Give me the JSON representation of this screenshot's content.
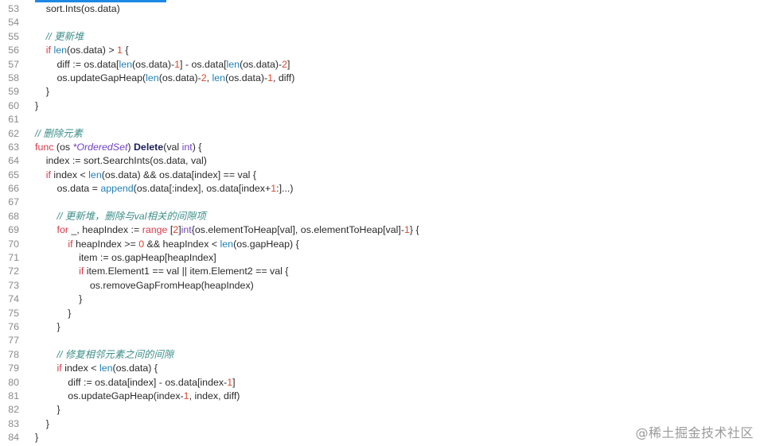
{
  "colors": {
    "keyword": "#d73a49",
    "builtin": "#1f7fb7",
    "number": "#d9482b",
    "comment": "#3d8f8a",
    "type": "#6f42c1",
    "text": "#2b2b2b",
    "accent": "#1e88e5"
  },
  "watermark": "@稀土掘金技术社区",
  "lines": [
    {
      "n": "53",
      "t": [
        [
          "",
          "    sort.Ints(os.data)"
        ]
      ]
    },
    {
      "n": "54",
      "t": []
    },
    {
      "n": "55",
      "t": [
        [
          "",
          "    "
        ],
        [
          "cm",
          "// 更新堆"
        ]
      ]
    },
    {
      "n": "56",
      "t": [
        [
          "",
          "    "
        ],
        [
          "kw",
          "if"
        ],
        [
          "",
          " "
        ],
        [
          "fn",
          "len"
        ],
        [
          "",
          "(os.data) > "
        ],
        [
          "num",
          "1"
        ],
        [
          "",
          " {"
        ]
      ]
    },
    {
      "n": "57",
      "t": [
        [
          "",
          "        diff := os.data["
        ],
        [
          "fn",
          "len"
        ],
        [
          "",
          "(os.data)-"
        ],
        [
          "num",
          "1"
        ],
        [
          "",
          "] - os.data["
        ],
        [
          "fn",
          "len"
        ],
        [
          "",
          "(os.data)-"
        ],
        [
          "num",
          "2"
        ],
        [
          "",
          "]"
        ]
      ]
    },
    {
      "n": "58",
      "t": [
        [
          "",
          "        os.updateGapHeap("
        ],
        [
          "fn",
          "len"
        ],
        [
          "",
          "(os.data)-"
        ],
        [
          "num",
          "2"
        ],
        [
          "",
          ", "
        ],
        [
          "fn",
          "len"
        ],
        [
          "",
          "(os.data)-"
        ],
        [
          "num",
          "1"
        ],
        [
          "",
          ", diff)"
        ]
      ]
    },
    {
      "n": "59",
      "t": [
        [
          "",
          "    }"
        ]
      ]
    },
    {
      "n": "60",
      "t": [
        [
          "",
          "}"
        ]
      ]
    },
    {
      "n": "61",
      "t": []
    },
    {
      "n": "62",
      "t": [
        [
          "cm",
          "// 删除元素"
        ]
      ]
    },
    {
      "n": "63",
      "t": [
        [
          "kw",
          "func"
        ],
        [
          "",
          " (os "
        ],
        [
          "it",
          "*OrderedSet"
        ],
        [
          "",
          ") "
        ],
        [
          "bold",
          "Delete"
        ],
        [
          "",
          "(val "
        ],
        [
          "ty",
          "int"
        ],
        [
          "",
          ") {"
        ]
      ]
    },
    {
      "n": "64",
      "t": [
        [
          "",
          "    index := sort.SearchInts(os.data, val)"
        ]
      ]
    },
    {
      "n": "65",
      "t": [
        [
          "",
          "    "
        ],
        [
          "kw",
          "if"
        ],
        [
          "",
          " index < "
        ],
        [
          "fn",
          "len"
        ],
        [
          "",
          "(os.data) && os.data[index] == val {"
        ]
      ]
    },
    {
      "n": "66",
      "t": [
        [
          "",
          "        os.data = "
        ],
        [
          "fn",
          "append"
        ],
        [
          "",
          "(os.data[:index], os.data[index+"
        ],
        [
          "num",
          "1"
        ],
        [
          "",
          ":]...)"
        ]
      ]
    },
    {
      "n": "67",
      "t": []
    },
    {
      "n": "68",
      "t": [
        [
          "",
          "        "
        ],
        [
          "cm",
          "// 更新堆，删除与val相关的间隙项"
        ]
      ]
    },
    {
      "n": "69",
      "t": [
        [
          "",
          "        "
        ],
        [
          "kw",
          "for"
        ],
        [
          "",
          " _, heapIndex := "
        ],
        [
          "kw",
          "range"
        ],
        [
          "",
          " ["
        ],
        [
          "num",
          "2"
        ],
        [
          "",
          "]"
        ],
        [
          "ty",
          "int"
        ],
        [
          "",
          "{os.elementToHeap[val], os.elementToHeap[val]-"
        ],
        [
          "num",
          "1"
        ],
        [
          "",
          "} {"
        ]
      ]
    },
    {
      "n": "70",
      "t": [
        [
          "",
          "            "
        ],
        [
          "kw",
          "if"
        ],
        [
          "",
          " heapIndex >= "
        ],
        [
          "num",
          "0"
        ],
        [
          "",
          " && heapIndex < "
        ],
        [
          "fn",
          "len"
        ],
        [
          "",
          "(os.gapHeap) {"
        ]
      ]
    },
    {
      "n": "71",
      "t": [
        [
          "",
          "                item := os.gapHeap[heapIndex]"
        ]
      ]
    },
    {
      "n": "72",
      "t": [
        [
          "",
          "                "
        ],
        [
          "kw",
          "if"
        ],
        [
          "",
          " item.Element1 == val || item.Element2 == val {"
        ]
      ]
    },
    {
      "n": "73",
      "t": [
        [
          "",
          "                    os.removeGapFromHeap(heapIndex)"
        ]
      ]
    },
    {
      "n": "74",
      "t": [
        [
          "",
          "                }"
        ]
      ]
    },
    {
      "n": "75",
      "t": [
        [
          "",
          "            }"
        ]
      ]
    },
    {
      "n": "76",
      "t": [
        [
          "",
          "        }"
        ]
      ]
    },
    {
      "n": "77",
      "t": []
    },
    {
      "n": "78",
      "t": [
        [
          "",
          "        "
        ],
        [
          "cm",
          "// 修复相邻元素之间的间隙"
        ]
      ]
    },
    {
      "n": "79",
      "t": [
        [
          "",
          "        "
        ],
        [
          "kw",
          "if"
        ],
        [
          "",
          " index < "
        ],
        [
          "fn",
          "len"
        ],
        [
          "",
          "(os.data) {"
        ]
      ]
    },
    {
      "n": "80",
      "t": [
        [
          "",
          "            diff := os.data[index] - os.data[index-"
        ],
        [
          "num",
          "1"
        ],
        [
          "",
          "]"
        ]
      ]
    },
    {
      "n": "81",
      "t": [
        [
          "",
          "            os.updateGapHeap(index-"
        ],
        [
          "num",
          "1"
        ],
        [
          "",
          ", index, diff)"
        ]
      ]
    },
    {
      "n": "82",
      "t": [
        [
          "",
          "        }"
        ]
      ]
    },
    {
      "n": "83",
      "t": [
        [
          "",
          "    }"
        ]
      ]
    },
    {
      "n": "84",
      "t": [
        [
          "",
          "}"
        ]
      ]
    }
  ]
}
